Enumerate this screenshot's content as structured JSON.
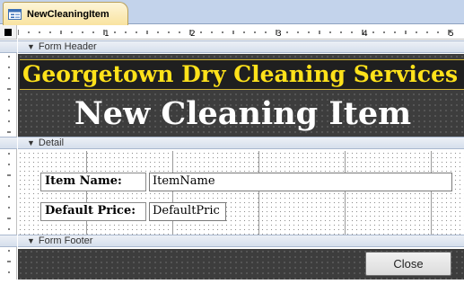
{
  "tab": {
    "label": "NewCleaningItem",
    "icon": "form-icon"
  },
  "ruler": {
    "numbers": [
      "1",
      "2",
      "3",
      "4",
      "5"
    ]
  },
  "sections": {
    "header_label": "Form Header",
    "detail_label": "Detail",
    "footer_label": "Form Footer"
  },
  "header": {
    "title": "Georgetown Dry Cleaning Services",
    "subtitle": "New Cleaning Item"
  },
  "detail": {
    "item_name_label": "Item Name:",
    "item_name_field": "ItemName",
    "default_price_label": "Default Price:",
    "default_price_field": "DefaultPric"
  },
  "footer": {
    "close_label": "Close"
  },
  "colors": {
    "title_text": "#ffe21a",
    "header_background": "#3d3d3d",
    "tab_accent": "#f9e3a0"
  }
}
